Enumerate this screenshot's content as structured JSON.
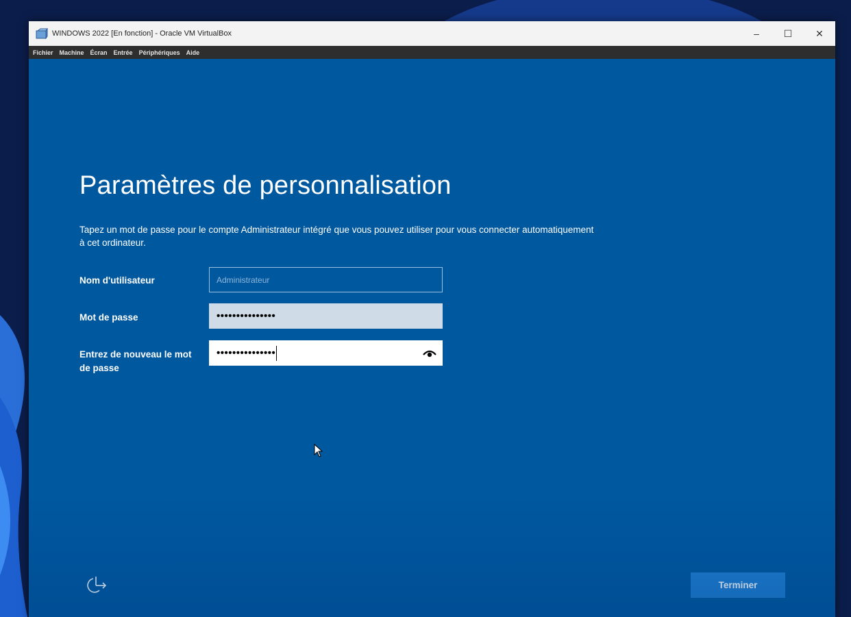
{
  "window": {
    "title": "WINDOWS 2022 [En fonction] - Oracle VM VirtualBox",
    "app_icon": "virtualbox-icon",
    "controls": {
      "minimize": "–",
      "maximize": "☐",
      "close": "✕"
    }
  },
  "menubar": {
    "items": [
      "Fichier",
      "Machine",
      "Écran",
      "Entrée",
      "Périphériques",
      "Aide"
    ]
  },
  "setup": {
    "title": "Paramètres de personnalisation",
    "description": "Tapez un mot de passe pour le compte Administrateur intégré que vous pouvez utiliser pour vous connecter automatiquement à cet ordinateur.",
    "fields": {
      "username": {
        "label": "Nom d'utilisateur",
        "placeholder": "Administrateur",
        "value": ""
      },
      "password": {
        "label": "Mot de passe",
        "value": "•••••••••••••••"
      },
      "confirm": {
        "label": "Entrez de nouveau le mot de passe",
        "value": "•••••••••••••••",
        "icon": "eye-reveal-icon"
      }
    },
    "finish_label": "Terminer",
    "accessibility_icon": "ease-of-access-icon"
  },
  "colors": {
    "setup_background": "#00589f",
    "button_background": "#1f7fd2",
    "titlebar": "#f3f3f3",
    "menubar": "#2e2e2e"
  }
}
